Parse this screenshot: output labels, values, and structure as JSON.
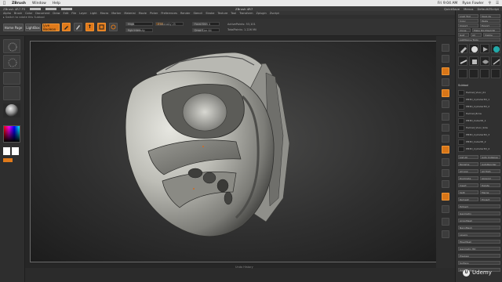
{
  "menubar": {
    "apple": "",
    "app_name": "ZBrush",
    "items": [
      "Window",
      "Help"
    ],
    "user": "Ryan Fowler",
    "clock": "Fri 9:04 AM"
  },
  "zb_title": {
    "app": "ZBrush 4R7 P3",
    "center": "ZBrush 4R7",
    "right_items": [
      "QuickSave",
      "Menus",
      "DefaultZScript"
    ]
  },
  "menu_items": [
    "Alpha",
    "Brush",
    "Color",
    "Document",
    "Draw",
    "Edit",
    "File",
    "Layer",
    "Light",
    "Macro",
    "Marker",
    "Material",
    "Movie",
    "Picker",
    "Preferences",
    "Render",
    "Stencil",
    "Stroke",
    "Texture",
    "Tool",
    "Transform",
    "Zplugin",
    "Zscript"
  ],
  "info_line": "▸ Switch to rotate this Subtool",
  "shelf": {
    "buttons": [
      "Home Page",
      "LightBox",
      "Live Boolean"
    ],
    "sliders": [
      {
        "label": "Mrgb",
        "fill": 0.3
      },
      {
        "label": "Rgb Intensity",
        "fill": 0.55
      },
      {
        "label": "Z Intensity 25",
        "fill": 0.25
      },
      {
        "label": "Focal Shift 0",
        "fill": 0.5
      },
      {
        "label": "Draw Size 64",
        "fill": 0.4
      }
    ],
    "readouts": [
      "ActivePoints: 53,101",
      "TotalPoints: 1.226 Mil"
    ]
  },
  "canvas": {
    "status": "Undo History",
    "colors": {
      "accent": "#e07a1b",
      "model": "#c9c9c2"
    }
  },
  "right_panel": {
    "title_rows": [
      [
        "Load Tool",
        "Save As"
      ],
      [
        "Copy",
        "Paste"
      ],
      [
        "Import",
        "Export"
      ],
      [
        "Clone",
        "Make PolyMesh3D"
      ],
      [
        "GoZ",
        "All",
        "Visible"
      ],
      [
        "Lightbox ▸ Tools"
      ]
    ],
    "subtool_label": "Subtool",
    "subtools": [
      "Helmet_Visor_01",
      "PM3D_Cylinder3D_1",
      "PM3D_Cylinder3D_2",
      "Helmet_Brow",
      "PM3D_Cube3D_1",
      "Helmet_Visor_Side",
      "PM3D_Cylinder3D_3",
      "PM3D_Cube3D_2",
      "PM3D_Cylinder3D_4"
    ],
    "bottom_rows": [
      [
        "List All",
        "Auto Collapse"
      ],
      [
        "Rename",
        "AutoReorder"
      ],
      [
        "All Low",
        "All High"
      ],
      [
        "Duplicate",
        "Append"
      ],
      [
        "Insert",
        "Delete"
      ],
      [
        "Split",
        "Merge"
      ],
      [
        "Remesh",
        "Project"
      ],
      [
        "Extract"
      ],
      [
        "Geometry"
      ],
      [
        "ArrayMesh"
      ],
      [
        "NanoMesh"
      ],
      [
        "Layers"
      ],
      [
        "FiberMesh"
      ],
      [
        "Geometry HD"
      ],
      [
        "Preview"
      ],
      [
        "Surface"
      ],
      [
        "Deformation"
      ]
    ]
  },
  "watermark": {
    "badge": "U",
    "text": "Udemy"
  }
}
